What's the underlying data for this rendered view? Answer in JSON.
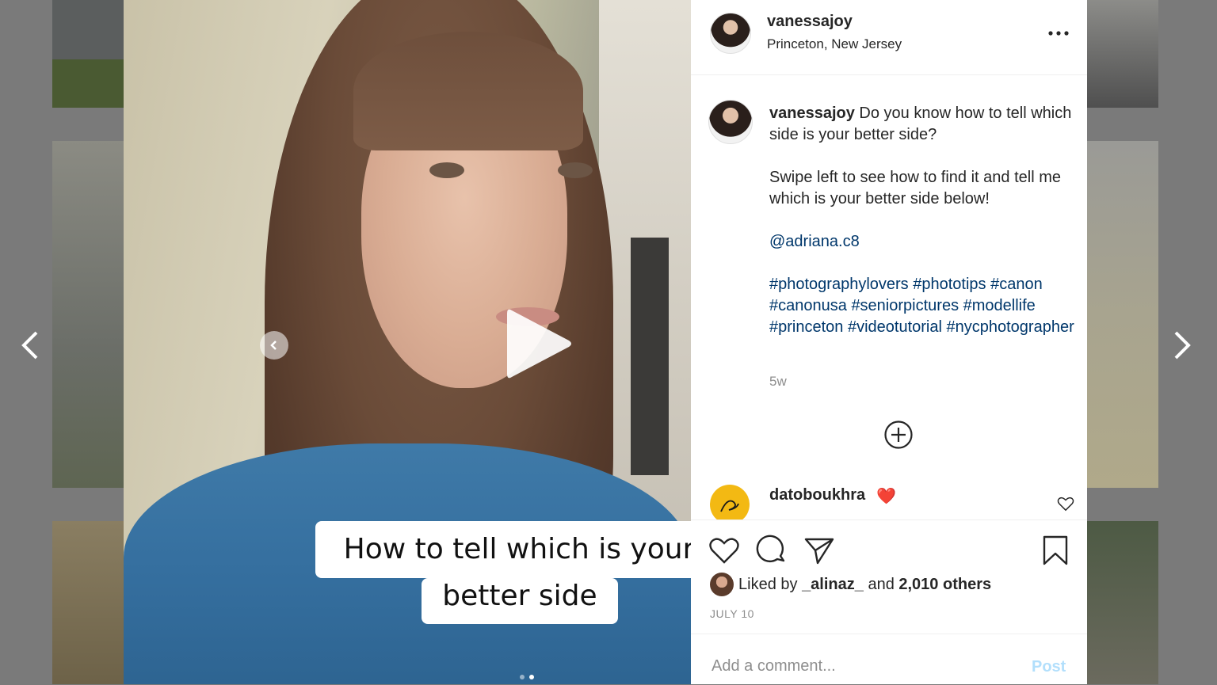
{
  "post": {
    "author": "vanessajoy",
    "location": "Princeton, New Jersey",
    "caption_user": "vanessajoy",
    "caption_line1": " Do you know how to tell which side is your better side?",
    "caption_line2": "Swipe left to see how to find it and tell me which is your better side below!",
    "mention": "@adriana.c8",
    "hashtags": [
      "#photographylovers",
      "#phototips",
      "#canon",
      "#canonusa",
      "#seniorpictures",
      "#modellife",
      "#princeton",
      "#videotutorial",
      "#nycphotographer"
    ],
    "time_ago": "5w"
  },
  "media": {
    "caption_line1": "How to tell which is your",
    "caption_line2": "better side",
    "carousel_count": 2,
    "carousel_active": 2
  },
  "comments": [
    {
      "user": "datoboukhra",
      "text": "❤️"
    }
  ],
  "likes": {
    "prefix": "Liked by ",
    "user": "_alinaz_",
    "middle": " and ",
    "others": "2,010 others"
  },
  "date": "JULY 10",
  "comment_form": {
    "placeholder": "Add a comment...",
    "post_label": "Post"
  },
  "colors": {
    "link": "#00376b",
    "post_button_disabled": "#b2dffc",
    "secondary_text": "#8e8e8e"
  },
  "icons": [
    "more-icon",
    "plus-circle-icon",
    "heart-icon",
    "comment-icon",
    "share-icon",
    "bookmark-icon",
    "play-icon",
    "chevron-left-icon",
    "chevron-right-icon"
  ]
}
